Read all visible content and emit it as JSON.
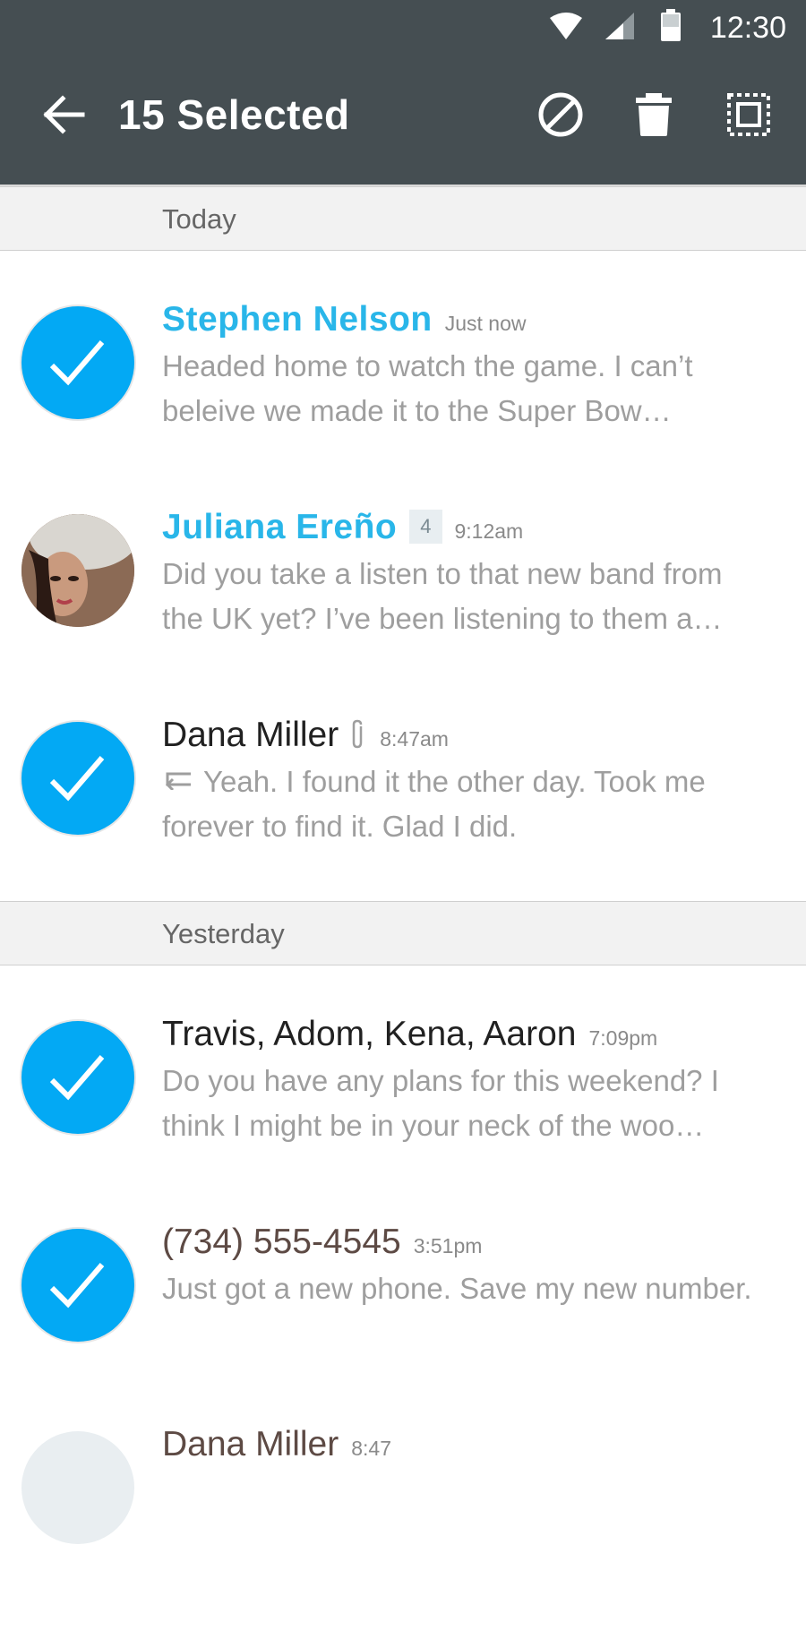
{
  "status_bar": {
    "time": "12:30",
    "icons": [
      "wifi-icon",
      "signal-icon",
      "battery-icon"
    ]
  },
  "toolbar": {
    "title": "15 Selected",
    "actions": [
      "back-arrow-icon",
      "block-icon",
      "trash-icon",
      "select-all-icon"
    ]
  },
  "colors": {
    "appbar": "#454e52",
    "accent": "#03a9f4",
    "unread_name": "#29b6e9"
  },
  "sections": [
    {
      "label": "Today",
      "conversations": [
        {
          "name": "Stephen Nelson",
          "time": "Just now",
          "selected": true,
          "unread": true,
          "preview": "Headed home to watch the game. I can’t beleive we made it to the Super Bow…"
        },
        {
          "name": "Juliana Ereño",
          "badge": "4",
          "time": "9:12am",
          "selected": false,
          "unread": true,
          "preview": "Did you take a listen to that new band from the UK yet? I’ve been listening to them a…"
        },
        {
          "name": "Dana Miller",
          "attachment": true,
          "time": "8:47am",
          "selected": true,
          "replied": true,
          "preview": "Yeah. I found it the other day. Took me forever to find it. Glad I did."
        }
      ]
    },
    {
      "label": "Yesterday",
      "conversations": [
        {
          "name": "Travis, Adom, Kena, Aaron",
          "time": "7:09pm",
          "selected": true,
          "preview": "Do you have any plans for this weekend? I think I might be in your neck of the woo…"
        },
        {
          "name": "(734) 555-4545",
          "time": "3:51pm",
          "selected": true,
          "preview": "Just got a new phone. Save my new number."
        },
        {
          "name": "Dana Miller",
          "time": "8:47",
          "selected": false,
          "preview": ""
        }
      ]
    }
  ]
}
